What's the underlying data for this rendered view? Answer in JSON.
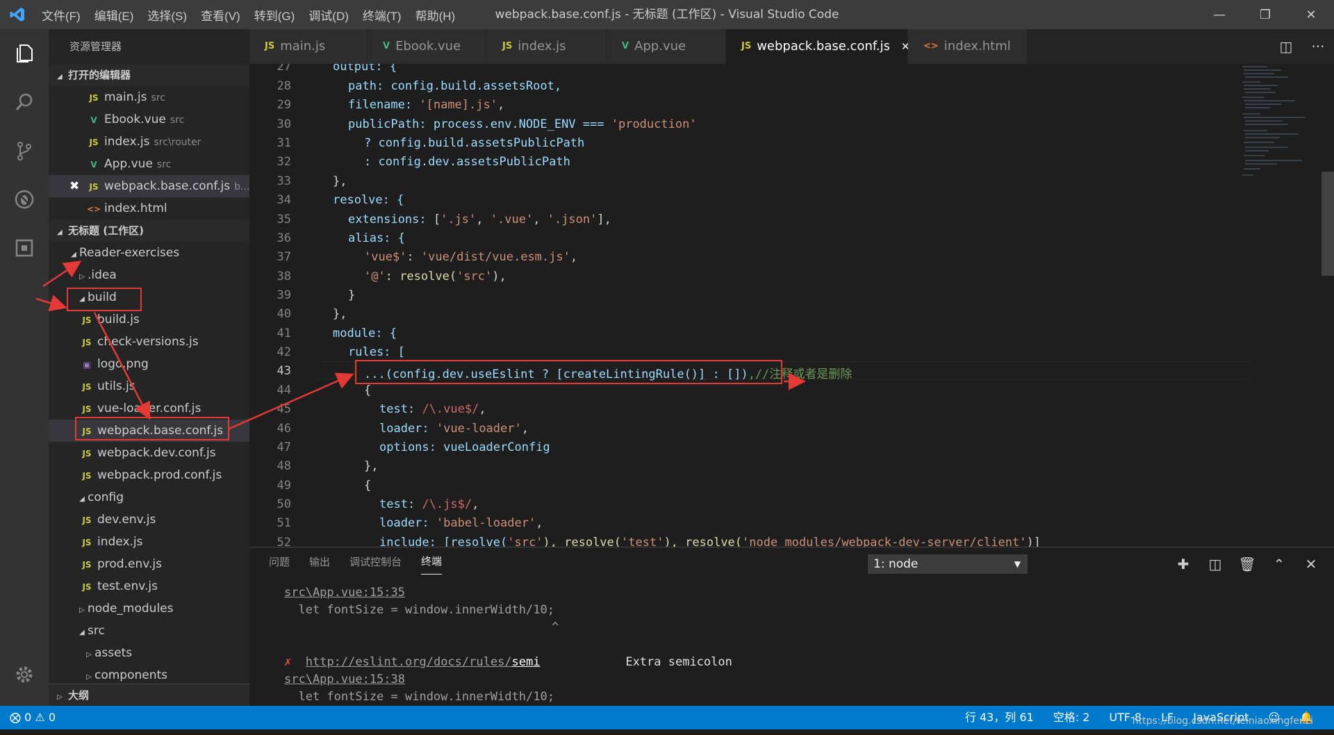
{
  "title_bar": {
    "logo": "vscode-logo",
    "window_title": "webpack.base.conf.js - 无标题 (工作区) - Visual Studio Code",
    "menu": [
      "文件(F)",
      "编辑(E)",
      "选择(S)",
      "查看(V)",
      "转到(G)",
      "调试(D)",
      "终端(T)",
      "帮助(H)"
    ]
  },
  "sidebar": {
    "header": "资源管理器",
    "open_editors": {
      "title": "打开的编辑器",
      "items": [
        {
          "icon": "JS",
          "name": "main.js",
          "path": "src"
        },
        {
          "icon": "V",
          "name": "Ebook.vue",
          "path": "src"
        },
        {
          "icon": "JS",
          "name": "index.js",
          "path": "src\\router"
        },
        {
          "icon": "V",
          "name": "App.vue",
          "path": "src"
        },
        {
          "icon": "JS",
          "name": "webpack.base.conf.js",
          "path": "b..."
        },
        {
          "icon": "<>",
          "name": "index.html",
          "path": ""
        }
      ]
    },
    "workspace": {
      "title": "无标题 (工作区)",
      "items": [
        {
          "name": "Reader-exercises",
          "icon": ""
        },
        {
          "name": ".idea",
          "icon": ""
        },
        {
          "name": "build",
          "icon": ""
        },
        {
          "name": "build.js",
          "icon": "JS"
        },
        {
          "name": "check-versions.js",
          "icon": "JS"
        },
        {
          "name": "logo.png",
          "icon": "img"
        },
        {
          "name": "utils.js",
          "icon": "JS"
        },
        {
          "name": "vue-loader.conf.js",
          "icon": "JS"
        },
        {
          "name": "webpack.base.conf.js",
          "icon": "JS"
        },
        {
          "name": "webpack.dev.conf.js",
          "icon": "JS"
        },
        {
          "name": "webpack.prod.conf.js",
          "icon": "JS"
        },
        {
          "name": "config",
          "icon": ""
        },
        {
          "name": "dev.env.js",
          "icon": "JS"
        },
        {
          "name": "index.js",
          "icon": "JS"
        },
        {
          "name": "prod.env.js",
          "icon": "JS"
        },
        {
          "name": "test.env.js",
          "icon": "JS"
        },
        {
          "name": "node_modules",
          "icon": ""
        },
        {
          "name": "src",
          "icon": ""
        },
        {
          "name": "assets",
          "icon": ""
        },
        {
          "name": "components",
          "icon": ""
        }
      ]
    },
    "outline": "大纲"
  },
  "tabs": [
    {
      "icon": "JS",
      "label": "main.js"
    },
    {
      "icon": "V",
      "label": "Ebook.vue"
    },
    {
      "icon": "JS",
      "label": "index.js"
    },
    {
      "icon": "V",
      "label": "App.vue"
    },
    {
      "icon": "JS",
      "label": "webpack.base.conf.js"
    },
    {
      "icon": "<>",
      "label": "index.html"
    }
  ],
  "editor": {
    "line_numbers": [
      "27",
      "28",
      "29",
      "30",
      "31",
      "32",
      "33",
      "34",
      "35",
      "36",
      "37",
      "38",
      "39",
      "40",
      "41",
      "42",
      "43",
      "44",
      "45",
      "46",
      "47",
      "48",
      "49",
      "50",
      "51",
      "52"
    ],
    "code": {
      "l27": "output: {",
      "l28a": "path:",
      "l28b": "config.build.assetsRoot,",
      "l29a": "filename:",
      "l29b": "'[name].js'",
      "l29c": ",",
      "l30a": "publicPath:",
      "l30b": "process.env.NODE_ENV ===",
      "l30c": "'production'",
      "l31": "? config.build.assetsPublicPath",
      "l32": ": config.dev.assetsPublicPath",
      "l33": "},",
      "l34": "resolve: {",
      "l35a": "extensions:",
      "l35b": "[",
      "l35c": "'.js'",
      "l35d": ",",
      "l35e": "'.vue'",
      "l35f": ",",
      "l35g": "'.json'",
      "l35h": "],",
      "l36": "alias: {",
      "l37a": "'vue$'",
      "l37b": ":",
      "l37c": "'vue/dist/vue.esm.js'",
      "l37d": ",",
      "l38a": "'@'",
      "l38b": ": resolve(",
      "l38c": "'src'",
      "l38d": "),",
      "l39": "}",
      "l40": "},",
      "l41": "module: {",
      "l42": "rules: [",
      "l43a": "...(config.dev.useEslint ? [createLintingRule()] : [])",
      "l43b": ",//注释或者是删除",
      "l44": "{",
      "l45a": "test:",
      "l45b": "/\\.vue$/",
      "l45c": ",",
      "l46a": "loader:",
      "l46b": "'vue-loader'",
      "l46c": ",",
      "l47a": "options:",
      "l47b": "vueLoaderConfig",
      "l48": "},",
      "l49": "{",
      "l50a": "test:",
      "l50b": "/\\.js$/",
      "l50c": ",",
      "l51a": "loader:",
      "l51b": "'babel-loader'",
      "l51c": ",",
      "l52a": "include: [resolve(",
      "l52b": "'src'",
      "l52c": "), resolve(",
      "l52d": "'test'",
      "l52e": "), resolve(",
      "l52f": "'node_modules/webpack-dev-server/client'",
      "l52g": ")]"
    }
  },
  "panel": {
    "tabs": [
      "问题",
      "输出",
      "调试控制台",
      "终端"
    ],
    "terminal_select": "1: node",
    "lines": {
      "t1": "src\\App.vue:15:35",
      "t2": "  let fontSize = window.innerWidth/10;",
      "t3": "^",
      "t4mark": "✗",
      "t4link": "http://eslint.org/docs/rules/",
      "t4rule": "semi",
      "t4msg": "Extra semicolon",
      "t5": "src\\App.vue:15:38",
      "t6": "  let fontSize = window.innerWidth/10;"
    }
  },
  "status": {
    "errors": "0",
    "warnings": "0",
    "position": "行 43，列 61",
    "spaces": "空格: 2",
    "encoding": "UTF-8",
    "eol": "LF",
    "language": "JavaScript"
  },
  "watermark": "https://blog.csdn.net/feiniaoxingfenzi",
  "colors": {
    "accent": "#007acc",
    "annotation_red": "#e53935"
  }
}
